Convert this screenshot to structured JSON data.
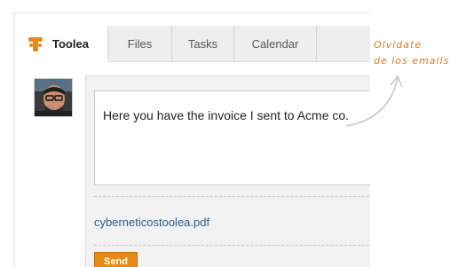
{
  "tabs": [
    {
      "label": "Toolea",
      "active": true
    },
    {
      "label": "Files",
      "active": false
    },
    {
      "label": "Tasks",
      "active": false
    },
    {
      "label": "Calendar",
      "active": false
    }
  ],
  "composer": {
    "message": "Here you have the invoice I sent to Acme co.",
    "attachment": "cyberneticostoolea.pdf",
    "send_label": "Send"
  },
  "annotation": {
    "line1": "Olvidate",
    "line2": "de los emails"
  },
  "colors": {
    "accent": "#e58a17",
    "link": "#2a5d8c",
    "annotation": "#e07a1f"
  },
  "icons": [
    "toolea-logo-icon",
    "user-avatar",
    "curved-arrow-icon"
  ]
}
